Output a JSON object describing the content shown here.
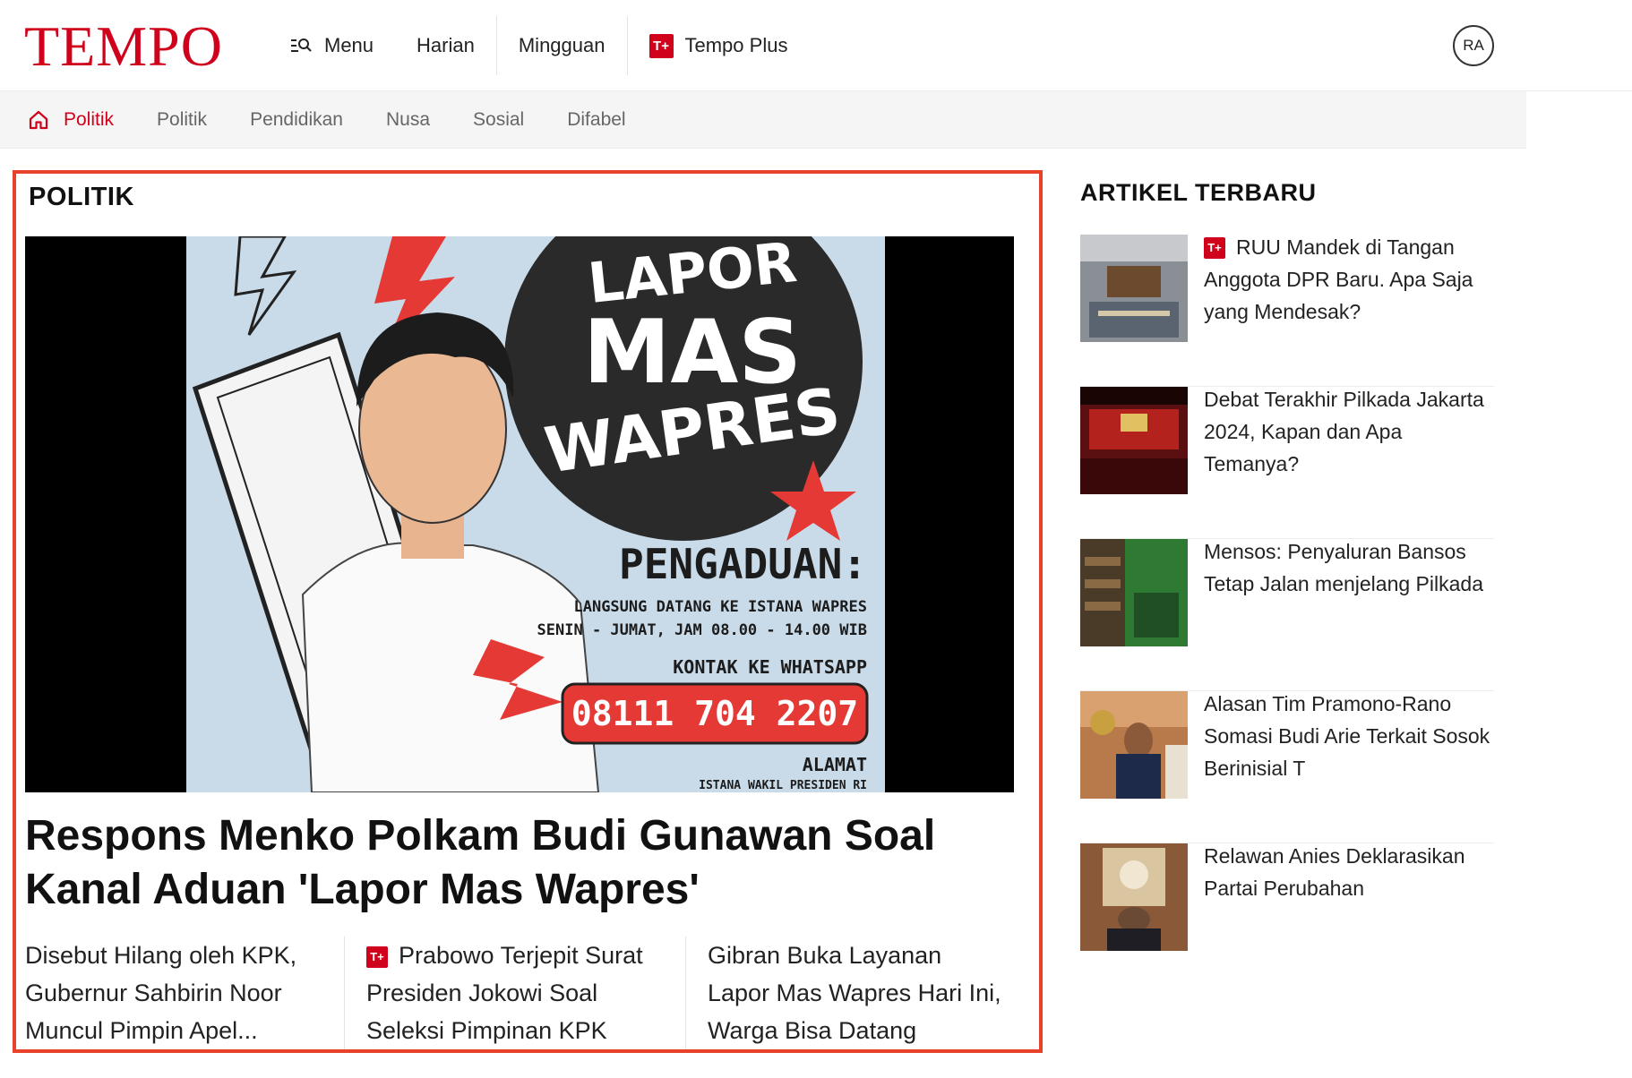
{
  "header": {
    "logo": "TEMPO",
    "nav": [
      {
        "label": "Menu",
        "icon": "menu-search-icon"
      },
      {
        "label": "Harian"
      },
      {
        "label": "Mingguan"
      },
      {
        "label": "Tempo Plus",
        "badge": "T+"
      }
    ],
    "avatar": "RA"
  },
  "subnav": {
    "items": [
      "Politik",
      "Politik",
      "Pendidikan",
      "Nusa",
      "Sosial",
      "Difabel"
    ],
    "active_index": 0
  },
  "main": {
    "section_title": "POLITIK",
    "poster": {
      "line1": "LAPOR",
      "line2": "MAS",
      "line3": "WAPRES",
      "heading": "PENGADUAN:",
      "sub1": "LANGSUNG DATANG KE ISTANA WAPRES",
      "sub2": "SENIN - JUMAT, JAM 08.00 - 14.00 WIB",
      "contact": "KONTAK KE WHATSAPP",
      "phone": "08111 704 2207",
      "address": "ALAMAT",
      "address_sub": "ISTANA WAKIL PRESIDEN RI"
    },
    "headline": "Respons Menko Polkam Budi Gunawan Soal Kanal Aduan 'Lapor Mas Wapres'",
    "sub_articles": [
      {
        "title": "Disebut Hilang oleh KPK, Gubernur Sahbirin Noor Muncul Pimpin Apel..."
      },
      {
        "badge": "T+",
        "title": "Prabowo Terjepit Surat Presiden Jokowi Soal Seleksi Pimpinan KPK"
      },
      {
        "title": "Gibran Buka Layanan Lapor Mas Wapres Hari Ini, Warga Bisa Datang Langsung ke..."
      }
    ]
  },
  "sidebar": {
    "title": "ARTIKEL TERBARU",
    "items": [
      {
        "badge": "T+",
        "title": "RUU Mandek di Tangan Anggota DPR Baru. Apa Saja yang Mendesak?"
      },
      {
        "title": "Debat Terakhir Pilkada Jakarta 2024, Kapan dan Apa Temanya?"
      },
      {
        "title": "Mensos: Penyaluran Bansos Tetap Jalan menjelang Pilkada"
      },
      {
        "title": "Alasan Tim Pramono-Rano Somasi Budi Arie Terkait Sosok Berinisial T"
      },
      {
        "title": "Relawan Anies Deklarasikan Partai Perubahan"
      }
    ]
  },
  "colors": {
    "brand": "#d0021b",
    "highlight_border": "#e8432a"
  }
}
